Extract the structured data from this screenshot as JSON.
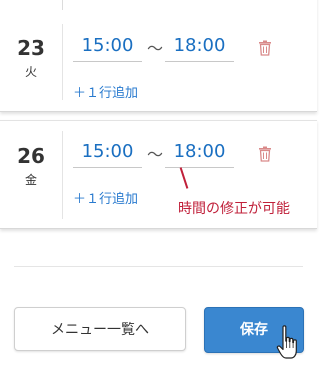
{
  "schedule": {
    "days": [
      {
        "day": "23",
        "weekday": "火",
        "start_time": "15:00",
        "separator": "～",
        "end_time": "18:00",
        "add_slot_label": "＋１行追加"
      },
      {
        "day": "26",
        "weekday": "金",
        "start_time": "15:00",
        "separator": "～",
        "end_time": "18:00",
        "add_slot_label": "＋１行追加"
      }
    ]
  },
  "annotation": {
    "text": "時間の修正が可能",
    "color": "#c0203a"
  },
  "footer": {
    "menu_button_label": "メニュー一覧へ",
    "save_button_label": "保存"
  },
  "colors": {
    "accent": "#3a87d0",
    "time_text": "#1a6fc1",
    "link": "#2a7bcf",
    "delete_icon": "#d98a8a"
  },
  "icons": {
    "delete": "trash-icon",
    "cursor": "hand-pointer-icon"
  }
}
